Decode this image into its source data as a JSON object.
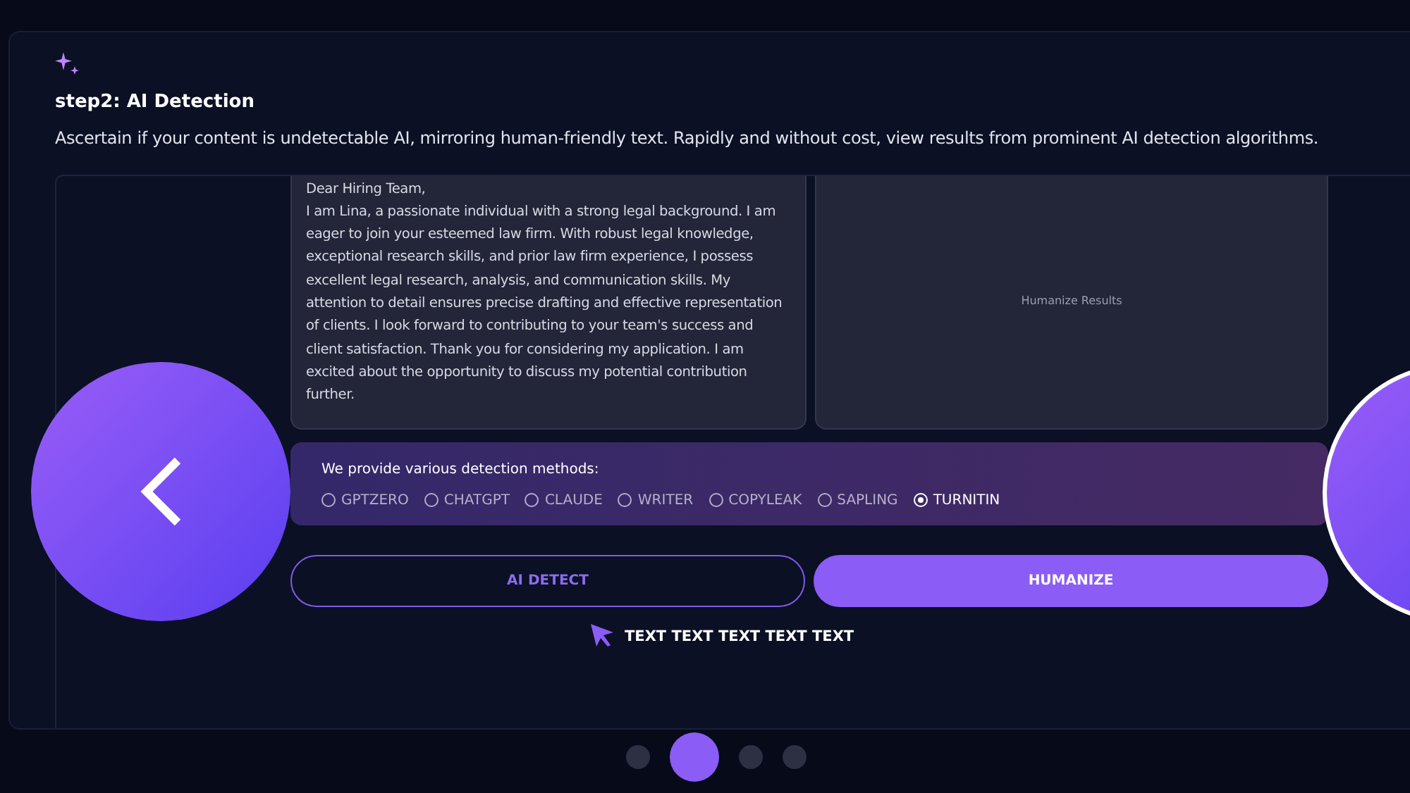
{
  "header": {
    "title": "step2: AI Detection",
    "description": "Ascertain if your content is undetectable AI, mirroring human-friendly text. Rapidly and without cost, view results from prominent AI detection algorithms."
  },
  "input_text": {
    "greeting": "Dear Hiring Team,",
    "body": "I am Lina, a passionate individual with a strong legal background. I am eager to join your esteemed law firm. With robust legal knowledge, exceptional research skills, and prior law firm experience, I possess excellent legal research, analysis, and communication skills. My attention to detail ensures precise drafting and effective representation of clients. I look forward to contributing to your team's success and client satisfaction. Thank you for considering my application. I am excited about the opportunity to discuss my potential contribution further."
  },
  "results": {
    "placeholder": "Humanize Results"
  },
  "detection": {
    "label": "We provide various detection methods:",
    "methods": [
      {
        "label": "GPTZERO",
        "selected": false
      },
      {
        "label": "CHATGPT",
        "selected": false
      },
      {
        "label": "CLAUDE",
        "selected": false
      },
      {
        "label": "WRITER",
        "selected": false
      },
      {
        "label": "COPYLEAK",
        "selected": false
      },
      {
        "label": "SAPLING",
        "selected": false
      },
      {
        "label": "TURNITIN",
        "selected": true
      }
    ]
  },
  "buttons": [
    {
      "label": "AI DETECT",
      "kind": "outline"
    },
    {
      "label": "HUMANIZE",
      "kind": "filled"
    }
  ],
  "hint": "TEXT TEXT TEXT TEXT TEXT",
  "pagination": [
    {
      "selected": false
    },
    {
      "selected": true
    },
    {
      "selected": false
    },
    {
      "selected": false
    }
  ]
}
